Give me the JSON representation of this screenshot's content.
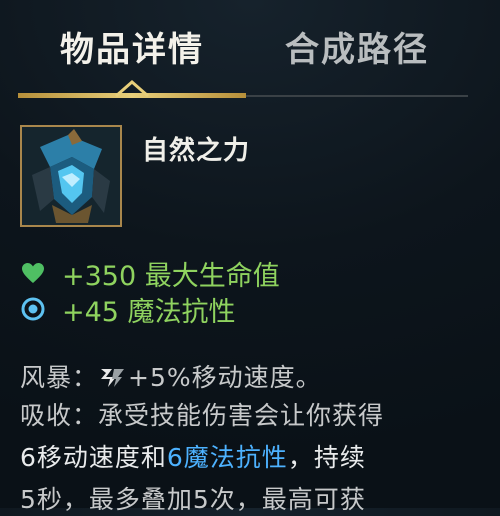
{
  "tabs": {
    "details_label": "物品详情",
    "recipe_label": "合成路径"
  },
  "item": {
    "name": "自然之力",
    "icon": "blue-armor-item-icon"
  },
  "stats": [
    {
      "icon": "heart-icon",
      "text": "+350 最大生命值",
      "color": "#8fd35f"
    },
    {
      "icon": "magic-resist-icon",
      "text": "+45 魔法抗性",
      "color": "#8fd35f"
    }
  ],
  "description": {
    "line1_prefix": "风暴：",
    "line1_icon": "move-speed-icon",
    "line1_text": "+5%移动速度。",
    "line2": "吸收：承受技能伤害会让你获得",
    "line3_part1": "6移动速度和",
    "line3_highlight": "6魔法抗性",
    "line3_part2": "，持续",
    "line4": "5秒，最多叠加5次，最高可获"
  },
  "colors": {
    "accent_gold": "#e8cf7a",
    "stat_green": "#8fd35f",
    "highlight_blue": "#4db2ff"
  }
}
